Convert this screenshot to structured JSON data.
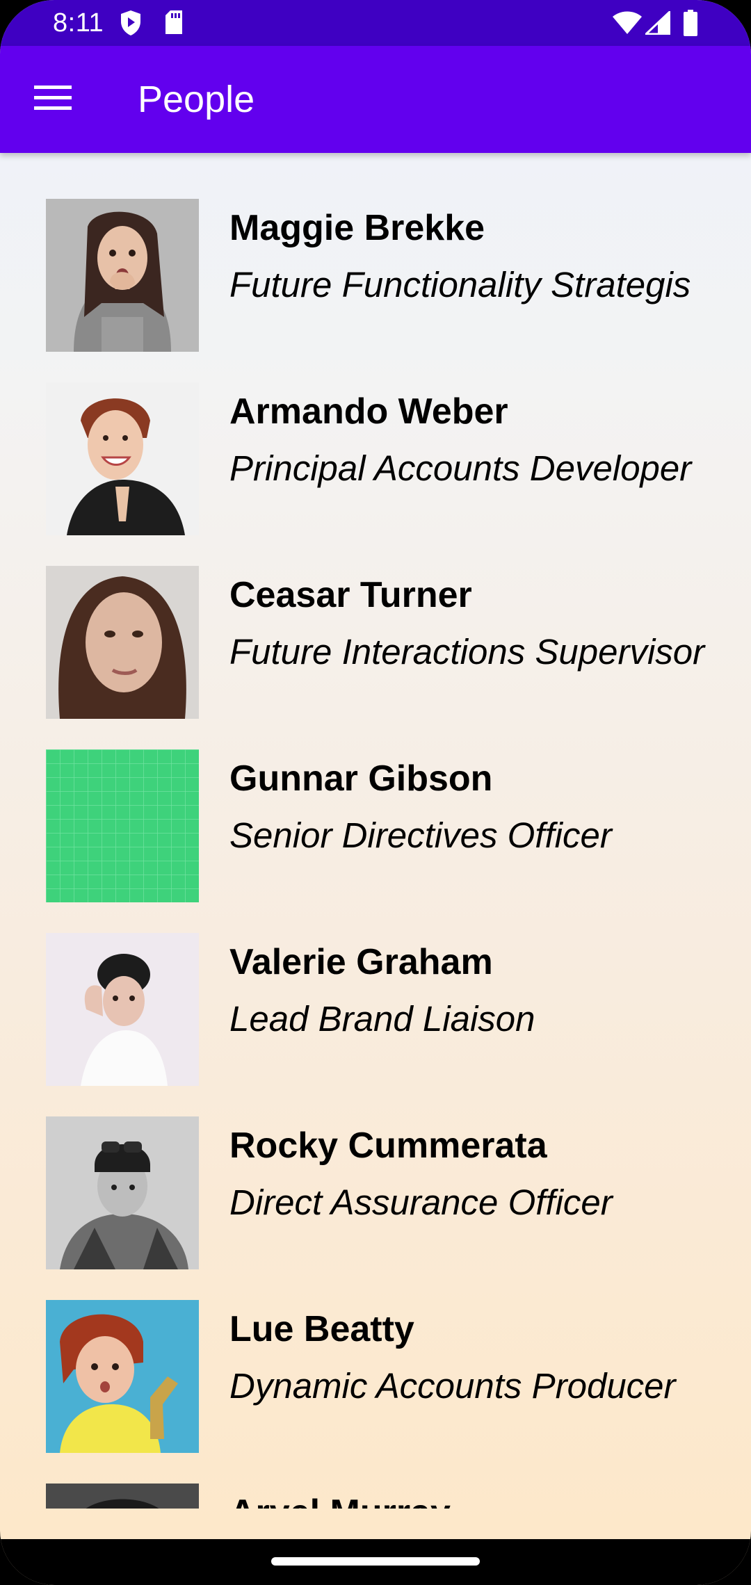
{
  "status_bar": {
    "time": "8:11",
    "icons": [
      "shield-icon",
      "sd-card-icon",
      "wifi-icon",
      "cell-signal-icon",
      "battery-icon"
    ]
  },
  "app_bar": {
    "title": "People",
    "menu_icon": "menu-icon"
  },
  "people": [
    {
      "name": "Maggie Brekke",
      "title": "Future Functionality Strategis"
    },
    {
      "name": "Armando Weber",
      "title": "Principal Accounts Developer"
    },
    {
      "name": "Ceasar Turner",
      "title": "Future Interactions Supervisor"
    },
    {
      "name": "Gunnar Gibson",
      "title": "Senior Directives Officer"
    },
    {
      "name": "Valerie Graham",
      "title": "Lead Brand Liaison"
    },
    {
      "name": "Rocky Cummerata",
      "title": "Direct Assurance Officer"
    },
    {
      "name": "Lue Beatty",
      "title": "Dynamic Accounts Producer"
    },
    {
      "name": "Arvel Murray",
      "title": ""
    }
  ],
  "colors": {
    "status_bar": "#3f00c2",
    "app_bar": "#6200ee"
  }
}
